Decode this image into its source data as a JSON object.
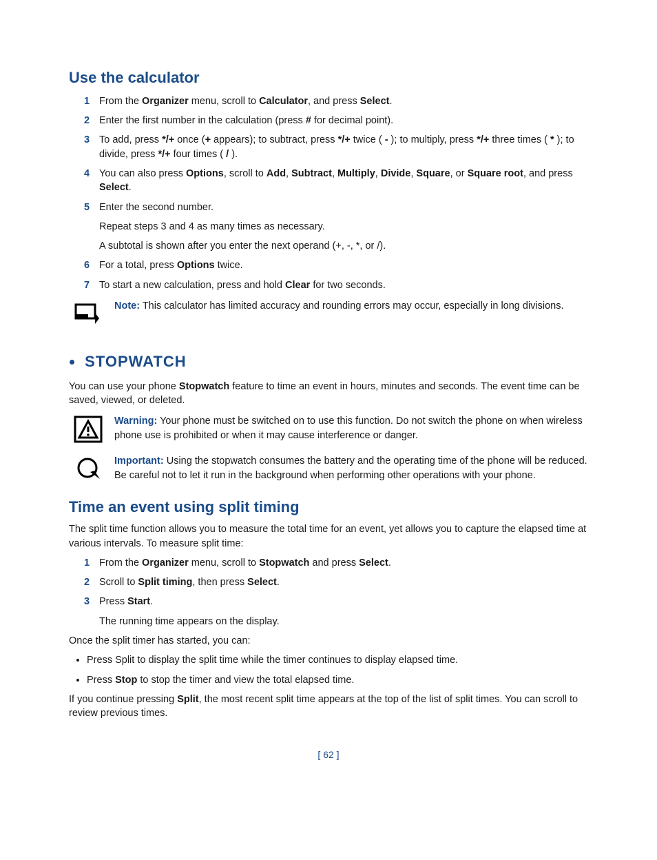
{
  "calc": {
    "heading": "Use the calculator",
    "s1": {
      "num": "1",
      "a": "From the ",
      "b1": "Organizer",
      "b": " menu, scroll to ",
      "b2": "Calculator",
      "c": ", and press ",
      "b3": "Select",
      "d": "."
    },
    "s2": {
      "num": "2",
      "a": "Enter the first number in the calculation (press ",
      "b1": "#",
      "b": " for decimal point)."
    },
    "s3": {
      "num": "3",
      "a": "To add, press ",
      "b1": "*/+",
      "b": " once (",
      "b2": "+",
      "c": " appears); to subtract, press ",
      "b3": "*/+",
      "d": " twice ( ",
      "b4": "-",
      "e": " ); to multiply, press ",
      "b5": "*/+",
      "f": " three times ( ",
      "b6": "*",
      "g": " ); to divide, press ",
      "b7": "*/+",
      "h": " four times ( ",
      "b8": "/",
      "i": " )."
    },
    "s4": {
      "num": "4",
      "a": "You can also press ",
      "b1": "Options",
      "b": ", scroll to ",
      "b2": "Add",
      "c": ", ",
      "b3": "Subtract",
      "d": ", ",
      "b4": "Multiply",
      "e": ", ",
      "b5": "Divide",
      "f": ", ",
      "b6": "Square",
      "g": ", or ",
      "b7": "Square root",
      "h": ", and press ",
      "b8": "Select",
      "i": "."
    },
    "s5": {
      "num": "5",
      "a": "Enter the second number."
    },
    "s5sub1": "Repeat steps 3 and 4 as many times as necessary.",
    "s5sub2": "A subtotal is shown after you enter the next operand (+, -, *, or /).",
    "s6": {
      "num": "6",
      "a": "For a total, press ",
      "b1": "Options",
      "b": " twice."
    },
    "s7": {
      "num": "7",
      "a": "To start a new calculation, press and hold ",
      "b1": "Clear",
      "b": " for two seconds."
    },
    "note": {
      "label": "Note:",
      "text": " This calculator has limited accuracy and rounding errors may occur, especially in long divisions."
    }
  },
  "stopwatch": {
    "bullet": "•",
    "heading": "Stopwatch",
    "intro_a": "You can use your phone ",
    "intro_b1": "Stopwatch",
    "intro_b": " feature to time an event in hours, minutes and seconds. The event time can be saved, viewed, or deleted.",
    "warning": {
      "label": "Warning:",
      "text": " Your phone must be switched on to use this function. Do not switch the phone on when wireless phone use is prohibited or when it may cause interference or danger."
    },
    "important": {
      "label": "Important:",
      "text": " Using the stopwatch consumes the battery and the operating time of the phone will be reduced. Be careful not to let it run in the background when performing other operations with your phone."
    }
  },
  "split": {
    "heading": "Time an event using split timing",
    "intro": "The split time function allows you to measure the total time for an event, yet allows you to capture the elapsed time at various intervals. To measure split time:",
    "s1": {
      "num": "1",
      "a": "From the ",
      "b1": "Organizer",
      "b": " menu, scroll to ",
      "b2": "Stopwatch",
      "c": " and press ",
      "b3": "Select",
      "d": "."
    },
    "s2": {
      "num": "2",
      "a": "Scroll to ",
      "b1": "Split timing",
      "b": ", then press ",
      "b2": "Select",
      "c": "."
    },
    "s3": {
      "num": "3",
      "a": "Press ",
      "b1": "Start",
      "b": "."
    },
    "s3sub": "The running time appears on the display.",
    "after": "Once the split timer has started, you can:",
    "b1_a": "Press Split to display the split time while the timer continues to display elapsed time.",
    "b2_a": "Press ",
    "b2_b1": "Stop",
    "b2_b": " to stop the timer and view the total elapsed time.",
    "final_a": "If you continue pressing ",
    "final_b1": "Split",
    "final_b": ", the most recent split time appears at the top of the list of split times. You can scroll to review previous times."
  },
  "page": "[ 62 ]"
}
